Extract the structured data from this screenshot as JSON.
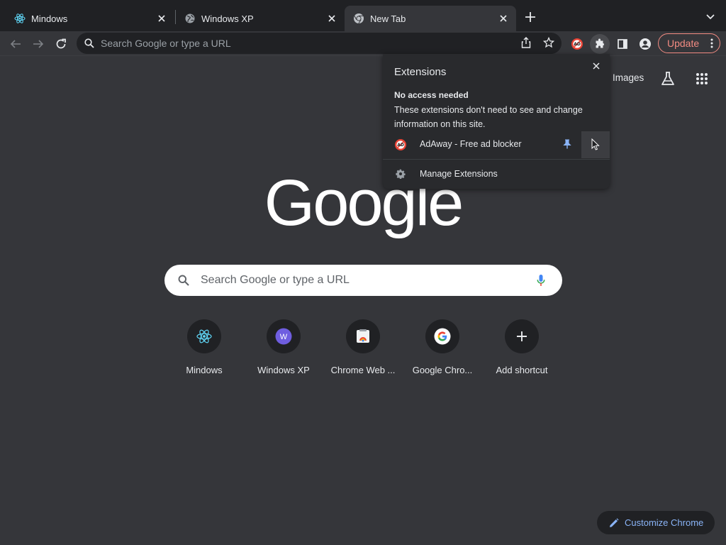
{
  "tabs": [
    {
      "title": "Mindows",
      "favicon": "react-icon",
      "active": false
    },
    {
      "title": "Windows XP",
      "favicon": "globe-icon",
      "active": false
    },
    {
      "title": "New Tab",
      "favicon": "chrome-icon",
      "active": true
    }
  ],
  "toolbar": {
    "omnibox_placeholder": "Search Google or type a URL",
    "update_label": "Update"
  },
  "extensions_popup": {
    "title": "Extensions",
    "section_heading": "No access needed",
    "section_description": "These extensions don't need to see and change information on this site.",
    "extensions": [
      {
        "name": "AdAway - Free ad blocker",
        "icon": "adaway-icon",
        "pinned": true
      }
    ],
    "manage_label": "Manage Extensions"
  },
  "ntp": {
    "images_link": "Images",
    "logo_text": "Google",
    "search_placeholder": "Search Google or type a URL",
    "shortcuts": [
      {
        "title": "Mindows",
        "icon": "react-icon"
      },
      {
        "title": "Windows XP",
        "icon": "w-letter-icon"
      },
      {
        "title": "Chrome Web ...",
        "icon": "chrome-web-store-icon"
      },
      {
        "title": "Google Chro...",
        "icon": "google-g-icon"
      },
      {
        "title": "Add shortcut",
        "icon": "plus-icon"
      }
    ],
    "customize_label": "Customize Chrome"
  },
  "colors": {
    "background": "#35363a",
    "tabstrip": "#202124",
    "accent_blue": "#8ab4f8",
    "update_red": "#f28b82"
  }
}
